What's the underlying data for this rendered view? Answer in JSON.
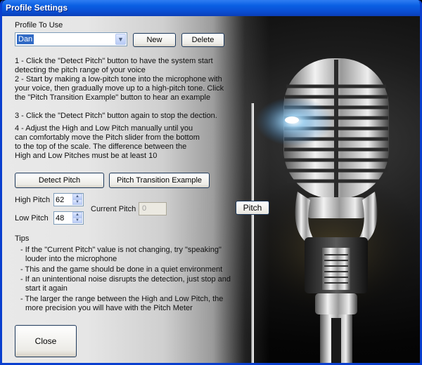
{
  "window": {
    "title": "Profile Settings"
  },
  "profile": {
    "label": "Profile To Use",
    "selected": "Dan",
    "new_label": "New",
    "delete_label": "Delete"
  },
  "instructions": [
    "1 - Click the \"Detect Pitch\" button to have the system start",
    "detecting the pitch range of your voice",
    "2 - Start by making a low-pitch tone into the microphone with",
    "your voice, then gradually move up to a high-pitch tone.  Click",
    "the \"Pitch Transition Example\" button to hear an example",
    "3 - Click the \"Detect Pitch\" button again to stop the dection.",
    "4 - Adjust the High and Low Pitch manually until you",
    "can comfortably move the Pitch slider from the bottom",
    "to the top of the scale.  The difference between the",
    "High and Low Pitches must be at least 10"
  ],
  "buttons": {
    "detect": "Detect Pitch",
    "example": "Pitch Transition Example",
    "close": "Close"
  },
  "pitch": {
    "high_label": "High Pitch",
    "high_value": "62",
    "low_label": "Low Pitch",
    "low_value": "48",
    "current_label": "Current Pitch",
    "current_value": "0",
    "slider_label": "Pitch"
  },
  "tips": {
    "heading": "Tips",
    "lines": [
      "- If the \"Current Pitch\" value is not changing, try \"speaking\"",
      "louder into the microphone",
      "- This and the game should be done in a quiet environment",
      "- If an unintentional noise disrupts the detection, just stop and",
      "start it again",
      "- The larger the range between the High and Low Pitch, the",
      "more precision you will have with the Pitch Meter"
    ]
  },
  "icons": [
    "chevron-down-icon",
    "spin-up-icon",
    "spin-down-icon",
    "microphone-image"
  ],
  "colors": {
    "titlebar": "#0a4fd4",
    "selection": "#316ac5",
    "button_border": "#1e395b"
  }
}
